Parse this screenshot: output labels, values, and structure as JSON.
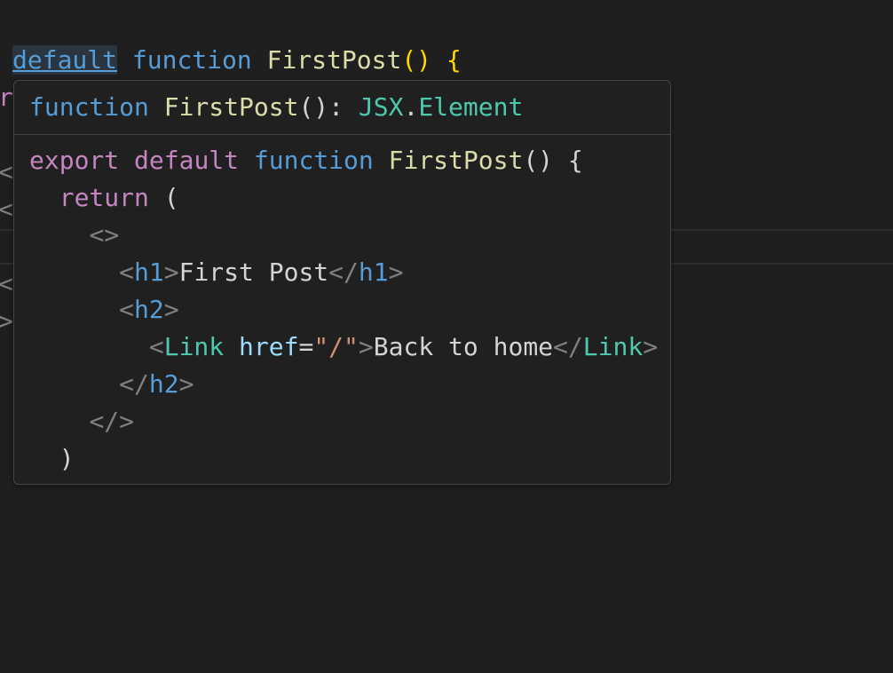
{
  "editor": {
    "line1": {
      "default": "default",
      "function": "function",
      "name": "FirstPost",
      "parens": "()",
      "brace": "{"
    },
    "fragments": {
      "r": "r",
      "lt1": "<",
      "lt2": "<",
      "lt3": "<",
      "gt": ">"
    }
  },
  "hover": {
    "signature": {
      "function": "function",
      "name": "FirstPost",
      "parens_colon": "(): ",
      "type_ns": "JSX",
      "dot": ".",
      "type_name": "Element"
    },
    "code": {
      "l1": {
        "export": "export",
        "default": "default",
        "function": "function",
        "name": "FirstPost",
        "rest": "() {"
      },
      "l2": {
        "return": "return",
        "paren": "("
      },
      "l3": {
        "frag_open": "<>"
      },
      "l4": {
        "lt": "<",
        "tag": "h1",
        "gt": ">",
        "text": "First Post",
        "close_lt": "</",
        "close_tag": "h1",
        "close_gt": ">"
      },
      "l5": {
        "lt": "<",
        "tag": "h2",
        "gt": ">"
      },
      "l6": {
        "lt": "<",
        "tag": "Link",
        "attr": "href",
        "eq": "=",
        "str": "\"/\"",
        "gt": ">",
        "text": "Back to home",
        "close_lt": "</",
        "close_tag": "Link",
        "close_gt": ">"
      },
      "l7": {
        "close_lt": "</",
        "tag": "h2",
        "gt": ">"
      },
      "l8": {
        "frag_close": "</>"
      },
      "l9": {
        "paren": ")"
      }
    }
  },
  "colors": {
    "background": "#1f1f1f",
    "keyword": "#569cd6",
    "control": "#c586c0",
    "function": "#dcdcaa",
    "type": "#4ec9b0",
    "attribute": "#9cdcfe",
    "string": "#ce9178",
    "punctuation": "#808080",
    "text": "#d4d4d4"
  }
}
